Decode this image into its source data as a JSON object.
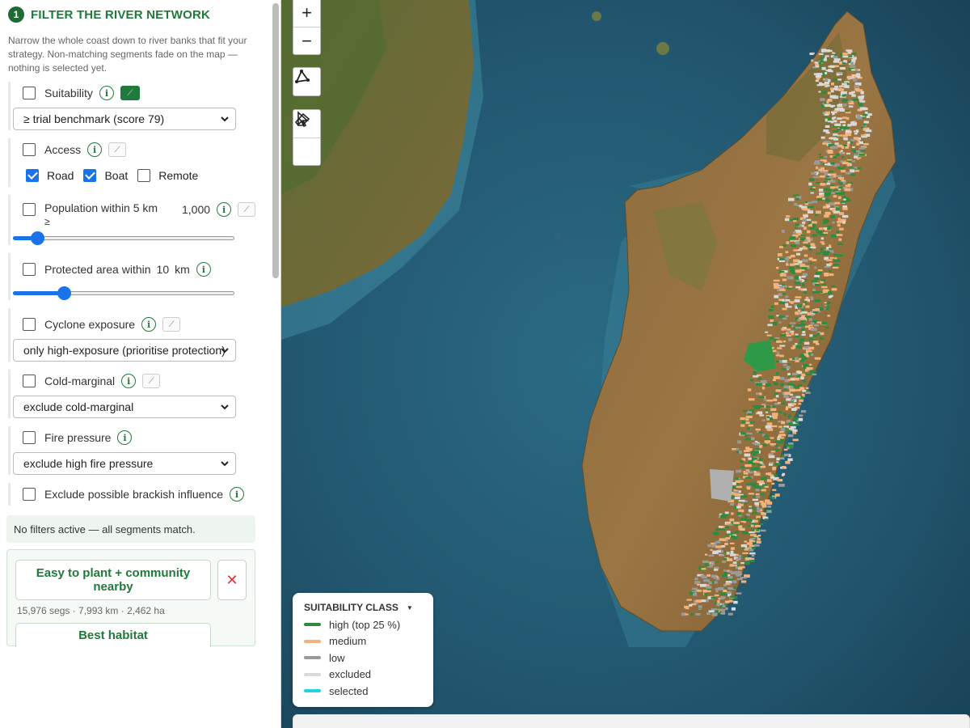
{
  "step": {
    "number": "1",
    "title": "FILTER THE RIVER NETWORK",
    "intro": "Narrow the whole coast down to river banks that fit your strategy. Non-matching segments fade on the map — nothing is selected yet."
  },
  "filters": {
    "suitability": {
      "label": "Suitability",
      "select": "≥ trial benchmark (score 79)"
    },
    "access": {
      "label": "Access",
      "options": [
        {
          "label": "Road",
          "checked": true
        },
        {
          "label": "Boat",
          "checked": true
        },
        {
          "label": "Remote",
          "checked": false
        }
      ]
    },
    "population": {
      "label": "Population within 5 km",
      "sub": "≥",
      "value": "1,000",
      "slider_fraction": 0.08
    },
    "protected": {
      "label": "Protected area within",
      "value": "10",
      "unit": "km",
      "slider_fraction": 0.2
    },
    "cyclone": {
      "label": "Cyclone exposure",
      "select": "only high-exposure (prioritise protection)"
    },
    "cold": {
      "label": "Cold-marginal",
      "select": "exclude cold-marginal"
    },
    "fire": {
      "label": "Fire pressure",
      "select": "exclude high fire pressure"
    },
    "brackish": {
      "label": "Exclude possible brackish influence"
    }
  },
  "status": "No filters active — all segments match.",
  "presets": [
    {
      "label": "Easy to plant + community nearby",
      "meta": "15,976 segs · 7,993 km · 2,462 ha",
      "remove": "✕"
    },
    {
      "label": "Best habitat"
    }
  ],
  "map_controls": {
    "zoom_in": "+",
    "zoom_out": "−"
  },
  "legend": {
    "title": "SUITABILITY CLASS",
    "items": [
      {
        "label": "high (top 25 %)",
        "color": "#2e8b3e"
      },
      {
        "label": "medium",
        "color": "#f2b27a"
      },
      {
        "label": "low",
        "color": "#9a9a9a"
      },
      {
        "label": "excluded",
        "color": "#d9d9d9"
      },
      {
        "label": "selected",
        "color": "#22d3e6"
      }
    ]
  },
  "colors": {
    "accent": "#1f7a3a",
    "toggle_blue": "#1a73e8"
  }
}
